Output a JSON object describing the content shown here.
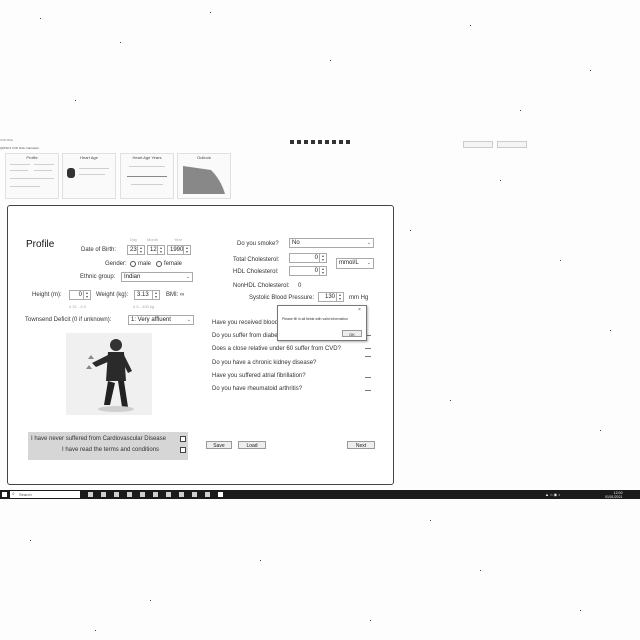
{
  "top": {
    "window_caption": "CVD Risk",
    "app_title": "QRISK3 CVD Risk Calculator",
    "thumbnails": [
      {
        "title": "Profile"
      },
      {
        "title": "Heart Age"
      },
      {
        "title": "Heart Age Years"
      },
      {
        "title": "Outlook"
      }
    ]
  },
  "profile": {
    "title": "Profile",
    "dob_label": "Date of Birth:",
    "dob_headers": {
      "day": "Day",
      "month": "Month",
      "year": "Year"
    },
    "dob": {
      "day": "23",
      "month": "12",
      "year": "1990"
    },
    "gender_label": "Gender:",
    "gender_options": [
      "male",
      "female"
    ],
    "ethnic_label": "Ethnic group:",
    "ethnic_value": "Indian",
    "height_label": "Height (m):",
    "height_value": "0",
    "height_hint": "0.31 - 4.0",
    "weight_label": "Weight (kg):",
    "weight_value": "3.13",
    "weight_hint": "0.5 - 400 kg",
    "bmi_label": "BMI:",
    "bmi_value": "∞",
    "townsend_label": "Townsend Deficit (0 if unknown):",
    "townsend_value": "1: Very affluent",
    "check_never_suffered": "I have never suffered from Cardiovascular Disease",
    "check_terms": "I have read the     terms and conditions"
  },
  "right": {
    "smoker_label": "Do you smoke?",
    "smoker_value": "No",
    "total_chol_label": "Total Cholesterol:",
    "total_chol_value": "0",
    "hdl_label": "HDL Cholesterol:",
    "hdl_value": "0",
    "units_value": "mmol/L",
    "nonhdl_label": "NonHDL Cholesterol:",
    "nonhdl_value": "0",
    "bp_label": "Systolic Blood Pressure:",
    "bp_value": "130",
    "bp_unit": "mm Hg",
    "questions": [
      "Have you received blood pressure treatment?",
      "Do you suffer from diabetes?",
      "Does a close relative under 60 suffer from CVD?",
      "Do you have a chronic kidney disease?",
      "Have you suffered atrial fibrillation?",
      "Do you have rheumatoid arthritis?"
    ]
  },
  "dialog": {
    "message": "Please fill in all fields with valid information",
    "ok_label": "OK"
  },
  "buttons": {
    "save": "Save",
    "load": "Load",
    "next": "Next"
  },
  "taskbar": {
    "search_placeholder": "Search",
    "time": "12:00",
    "date": "01/01/2021"
  }
}
